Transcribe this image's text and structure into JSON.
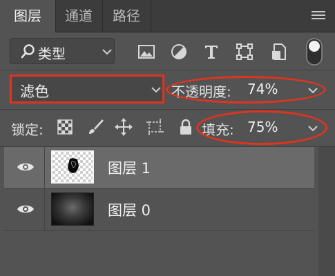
{
  "tabs": [
    {
      "label": "图层",
      "active": true
    },
    {
      "label": "通道",
      "active": false
    },
    {
      "label": "路径",
      "active": false
    }
  ],
  "filter": {
    "kind_label": "类型",
    "icons": [
      "image-filter-icon",
      "adjustment-filter-icon",
      "type-filter-icon",
      "shape-filter-icon",
      "smart-object-filter-icon",
      "filter-toggle-icon"
    ]
  },
  "blend": {
    "mode": "滤色",
    "opacity_label": "不透明度:",
    "opacity_value": "74%"
  },
  "lock": {
    "label": "锁定:",
    "fill_label": "填充:",
    "fill_value": "75%"
  },
  "layers": [
    {
      "name": "图层 1",
      "selected": true,
      "visible": true
    },
    {
      "name": "图层 0",
      "selected": false,
      "visible": true
    }
  ],
  "colors": {
    "highlight": "#e0341f",
    "panel": "#535353",
    "tabbar": "#3c3c3c",
    "selected_row": "#6a6a6a"
  }
}
